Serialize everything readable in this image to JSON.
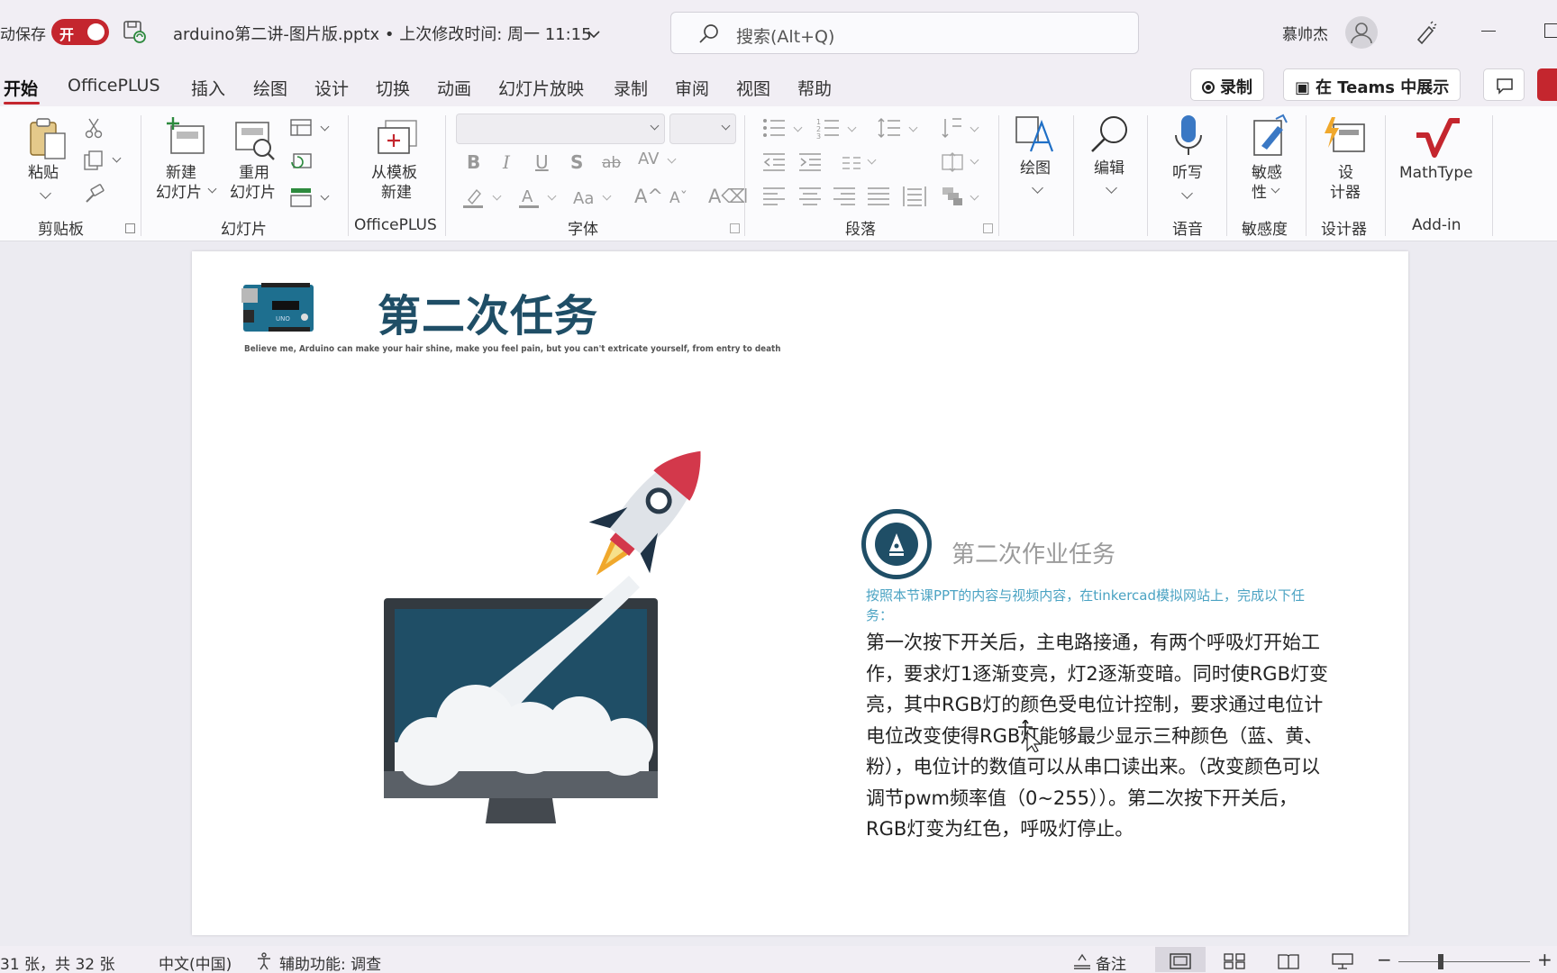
{
  "titlebar": {
    "autosave_label": "动保存",
    "autosave_state": "开",
    "doc_title": "arduino第二讲-图片版.pptx • 上次修改时间: 周一 11:15",
    "search_placeholder": "搜索(Alt+Q)",
    "username": "慕帅杰"
  },
  "tabs": [
    "开始",
    "OfficePLUS",
    "插入",
    "绘图",
    "设计",
    "切换",
    "动画",
    "幻灯片放映",
    "录制",
    "审阅",
    "视图",
    "帮助"
  ],
  "actions": {
    "record": "录制",
    "teams": "在 Teams 中展示"
  },
  "ribbon": {
    "paste": "粘贴",
    "new_slide_1": "新建",
    "new_slide_2": "幻灯片",
    "reuse_1": "重用",
    "reuse_2": "幻灯片",
    "template_1": "从模板",
    "template_2": "新建",
    "draw": "绘图",
    "edit": "编辑",
    "dictate": "听写",
    "sensitivity_1": "敏感",
    "sensitivity_2": "性",
    "designer_1": "设",
    "designer_2": "计器",
    "mathtype": "MathType",
    "groups": {
      "clipboard": "剪贴板",
      "slides": "幻灯片",
      "officeplus": "OfficePLUS",
      "font": "字体",
      "paragraph": "段落",
      "voice": "语音",
      "sensitivity": "敏感度",
      "designer": "设计器",
      "addin": "Add-in"
    }
  },
  "slide": {
    "title": "第二次任务",
    "subtitle": "Believe me, Arduino can make your hair shine, make you feel pain, but you can't extricate yourself, from entry to death",
    "task_heading": "第二次作业任务",
    "task_intro": "按照本节课PPT的内容与视频内容，在tinkercad模拟网站上，完成以下任务：",
    "task_body": "第一次按下开关后，主电路接通，有两个呼吸灯开始工作，要求灯1逐渐变亮，灯2逐渐变暗。同时使RGB灯变亮，其中RGB灯的颜色受电位计控制，要求通过电位计电位改变使得RGB灯能够最少显示三种颜色（蓝、黄、粉），电位计的数值可以从串口读出来。（改变颜色可以调节pwm频率值（0~255））。第二次按下开关后，RGB灯变为红色，呼吸灯停止。"
  },
  "statusbar": {
    "slide_count": "31 张，共 32 张",
    "language": "中文(中国)",
    "accessibility": "辅助功能: 调查",
    "notes": "备注"
  }
}
